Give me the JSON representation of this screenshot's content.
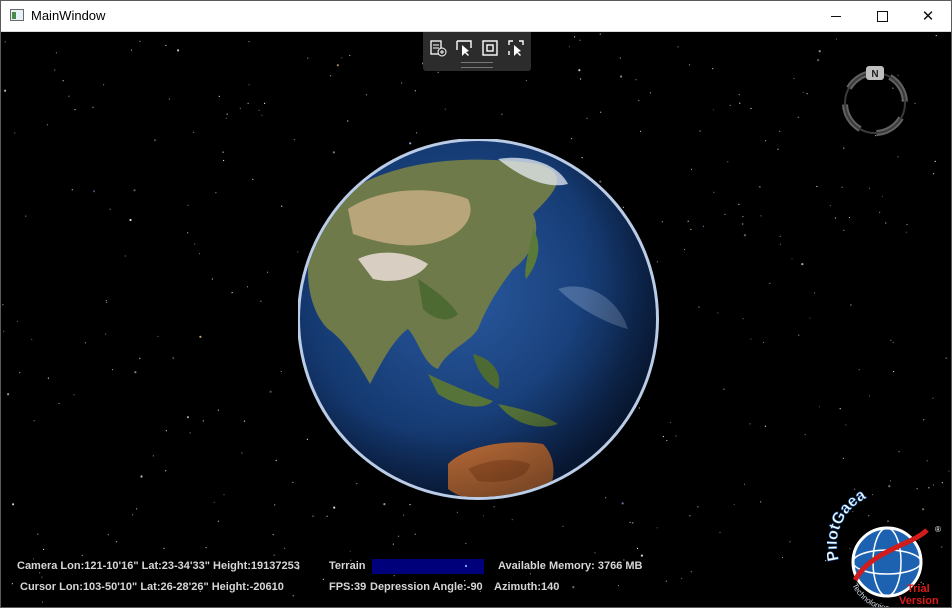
{
  "window": {
    "title": "MainWindow"
  },
  "toolbar": {
    "buttons": [
      {
        "icon": "layer-add-icon"
      },
      {
        "icon": "select-pointer-icon"
      },
      {
        "icon": "frame-icon"
      },
      {
        "icon": "select-area-icon"
      }
    ]
  },
  "compass": {
    "north_label": "N"
  },
  "status": {
    "camera": "Camera Lon:121-10'16\" Lat:23-34'33\" Height:19137253",
    "cursor": "Cursor Lon:103-50'10\" Lat:26-28'26\" Height:-20610",
    "terrain_label": "Terrain",
    "fps": "FPS:39",
    "depression": "Depression Angle:-90",
    "azimuth": "Azimuth:140",
    "memory": "Available Memory: 3766 MB"
  },
  "logo": {
    "brand": "PilotGaea",
    "sub": "Technologies",
    "trial1": "Trial",
    "trial2": "Version"
  },
  "colors": {
    "ocean": "#1b3f7a",
    "terrain_bar": "#00007a",
    "status_text": "#d6d6d6"
  }
}
